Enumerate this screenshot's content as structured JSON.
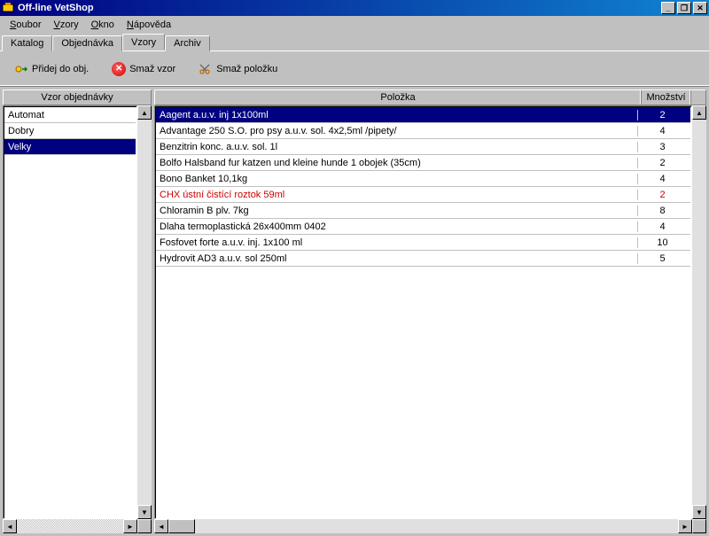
{
  "window": {
    "title": "Off-line VetShop"
  },
  "menu": {
    "items": [
      {
        "label": "Soubor",
        "ul": "S",
        "rest": "oubor"
      },
      {
        "label": "Vzory",
        "ul": "V",
        "rest": "zory"
      },
      {
        "label": "Okno",
        "ul": "O",
        "rest": "kno"
      },
      {
        "label": "Nápověda",
        "ul": "N",
        "rest": "ápověda"
      }
    ]
  },
  "tabs": {
    "items": [
      "Katalog",
      "Objednávka",
      "Vzory",
      "Archiv"
    ],
    "active": 2
  },
  "toolbar": {
    "add": "Přidej do obj.",
    "delete_template": "Smaž vzor",
    "delete_item": "Smaž položku"
  },
  "left": {
    "header": "Vzor objednávky",
    "items": [
      "Automat",
      "Dobry",
      "Velky"
    ],
    "selected": 2
  },
  "right": {
    "header_item": "Položka",
    "header_qty": "Množství",
    "rows": [
      {
        "name": "Aagent a.u.v. inj 1x100ml",
        "qty": "2",
        "selected": true
      },
      {
        "name": "Advantage 250 S.O. pro psy a.u.v. sol. 4x2,5ml /pipety/",
        "qty": "4"
      },
      {
        "name": "Benzitrin konc. a.u.v. sol. 1l",
        "qty": "3"
      },
      {
        "name": "Bolfo Halsband fur katzen und kleine hunde 1 obojek  (35cm)",
        "qty": "2"
      },
      {
        "name": "Bono Banket 10,1kg",
        "qty": "4"
      },
      {
        "name": "CHX ústní čistící roztok 59ml",
        "qty": "2",
        "red": true
      },
      {
        "name": "Chloramin B plv. 7kg",
        "qty": "8"
      },
      {
        "name": "Dlaha termoplastická 26x400mm     0402",
        "qty": "4"
      },
      {
        "name": "Fosfovet forte a.u.v. inj. 1x100 ml",
        "qty": "10"
      },
      {
        "name": "Hydrovit AD3 a.u.v. sol 250ml",
        "qty": "5"
      }
    ]
  }
}
